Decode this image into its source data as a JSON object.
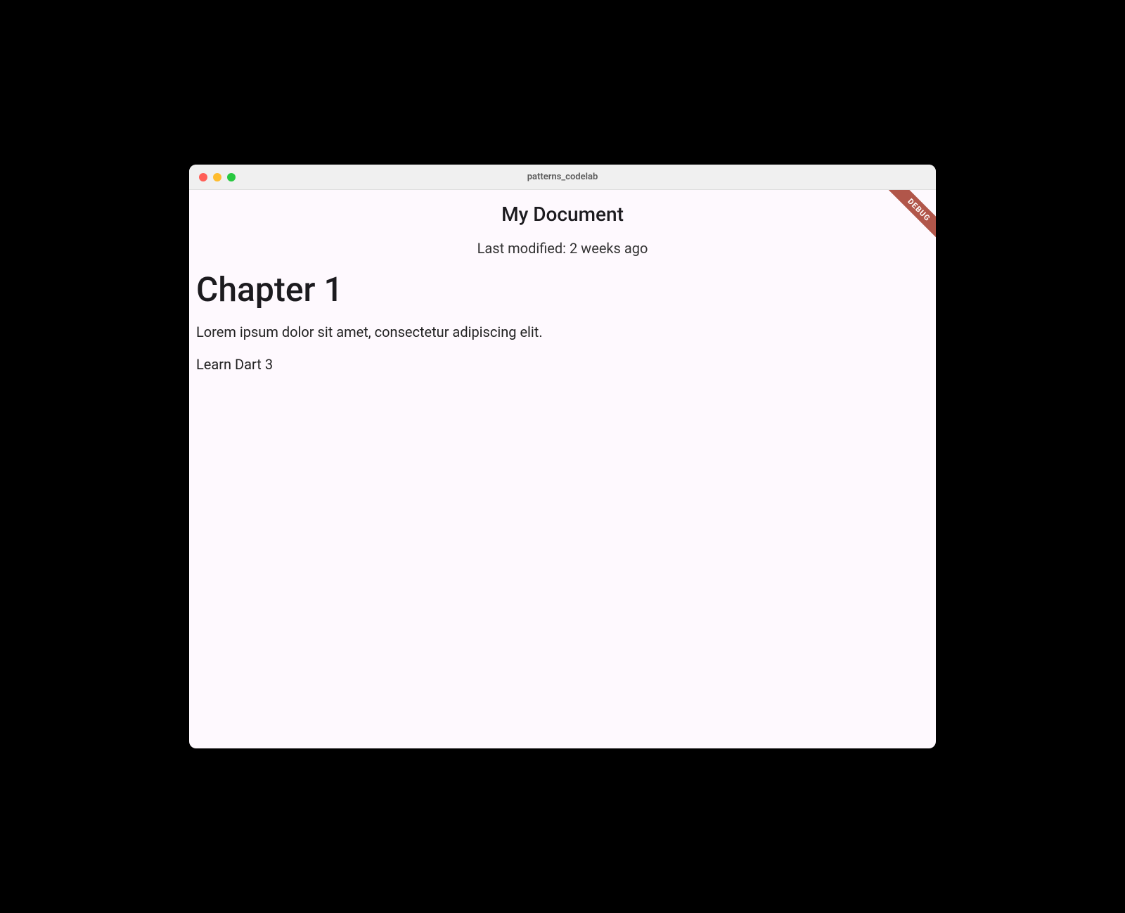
{
  "window": {
    "title": "patterns_codelab"
  },
  "debug_banner": "DEBUG",
  "header": {
    "title": "My Document",
    "last_modified": "Last modified: 2 weeks ago"
  },
  "content": {
    "chapter_heading": "Chapter 1",
    "paragraph": "Lorem ipsum dolor sit amet, consectetur adipiscing elit.",
    "list_item": "Learn Dart 3"
  }
}
